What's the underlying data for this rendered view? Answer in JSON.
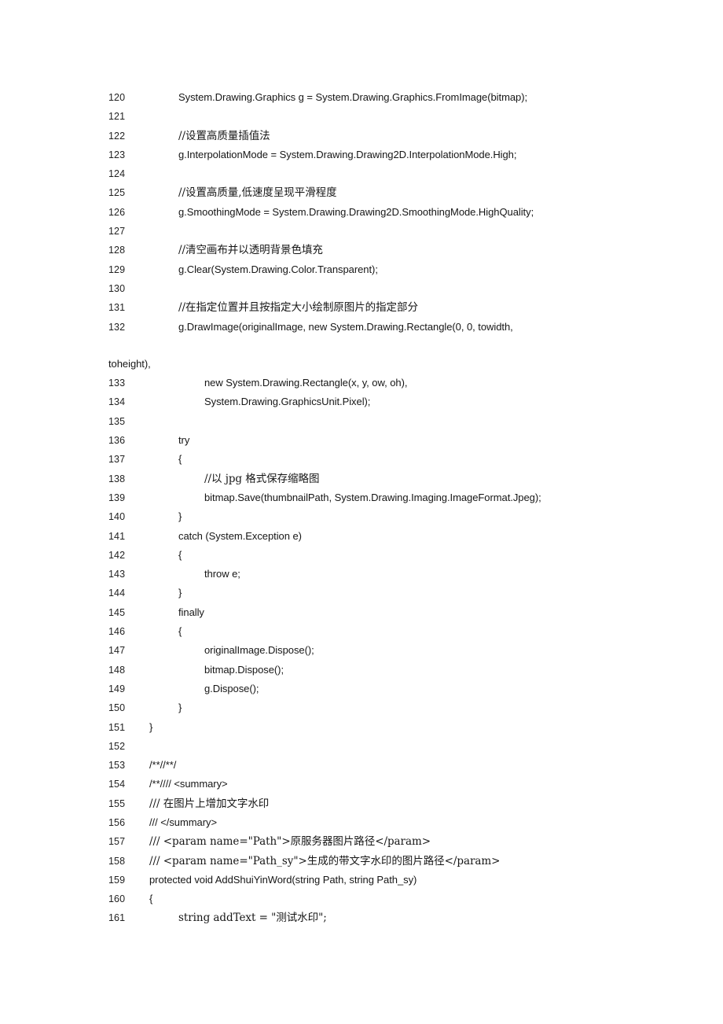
{
  "document": {
    "type": "code-listing",
    "language": "C#",
    "background_color": "#ffffff",
    "text_color": "#161616",
    "first_line_number": 120,
    "last_line_number": 161
  },
  "lines": [
    {
      "n": "120",
      "indent": "i1",
      "text": "System.Drawing.Graphics g = System.Drawing.Graphics.FromImage(bitmap);"
    },
    {
      "n": "121",
      "indent": "i1",
      "text": ""
    },
    {
      "n": "122",
      "indent": "i1",
      "text": "//设置高质量插值法",
      "cjk": true
    },
    {
      "n": "123",
      "indent": "i1",
      "text": "g.InterpolationMode = System.Drawing.Drawing2D.InterpolationMode.High;"
    },
    {
      "n": "124",
      "indent": "i1",
      "text": ""
    },
    {
      "n": "125",
      "indent": "i1",
      "text": "//设置高质量,低速度呈现平滑程度",
      "cjk": true
    },
    {
      "n": "126",
      "indent": "i1",
      "text": "g.SmoothingMode = System.Drawing.Drawing2D.SmoothingMode.HighQuality;"
    },
    {
      "n": "127",
      "indent": "i1",
      "text": ""
    },
    {
      "n": "128",
      "indent": "i1",
      "text": "//清空画布并以透明背景色填充",
      "cjk": true
    },
    {
      "n": "129",
      "indent": "i1",
      "text": "g.Clear(System.Drawing.Color.Transparent);"
    },
    {
      "n": "130",
      "indent": "i1",
      "text": ""
    },
    {
      "n": "131",
      "indent": "i1",
      "text": "//在指定位置并且按指定大小绘制原图片的指定部分",
      "cjk": true
    },
    {
      "n": "132",
      "indent": "i1",
      "text": "g.DrawImage(originalImage, new System.Drawing.Rectangle(0, 0, towidth,"
    }
  ],
  "wrapped_continuation": {
    "text": "toheight),",
    "belongs_to_line": "132"
  },
  "lines_after_wrap": [
    {
      "n": "133",
      "indent": "i2",
      "text": "new System.Drawing.Rectangle(x, y, ow, oh),"
    },
    {
      "n": "134",
      "indent": "i2",
      "text": "System.Drawing.GraphicsUnit.Pixel);"
    },
    {
      "n": "135",
      "indent": "i1",
      "text": ""
    },
    {
      "n": "136",
      "indent": "i1",
      "text": "try"
    },
    {
      "n": "137",
      "indent": "i1",
      "text": "{"
    },
    {
      "n": "138",
      "indent": "i2",
      "text": "//以 jpg 格式保存缩略图",
      "cjk": true
    },
    {
      "n": "139",
      "indent": "i2",
      "text": "bitmap.Save(thumbnailPath, System.Drawing.Imaging.ImageFormat.Jpeg);"
    },
    {
      "n": "140",
      "indent": "i1",
      "text": "}"
    },
    {
      "n": "141",
      "indent": "i1",
      "text": "catch (System.Exception e)"
    },
    {
      "n": "142",
      "indent": "i1",
      "text": "{"
    },
    {
      "n": "143",
      "indent": "i2",
      "text": "throw e;"
    },
    {
      "n": "144",
      "indent": "i1",
      "text": "}"
    },
    {
      "n": "145",
      "indent": "i1",
      "text": "finally"
    },
    {
      "n": "146",
      "indent": "i1",
      "text": "{"
    },
    {
      "n": "147",
      "indent": "i2",
      "text": "originalImage.Dispose();"
    },
    {
      "n": "148",
      "indent": "i2",
      "text": "bitmap.Dispose();"
    },
    {
      "n": "149",
      "indent": "i2",
      "text": "g.Dispose();"
    },
    {
      "n": "150",
      "indent": "i1",
      "text": "}"
    },
    {
      "n": "151",
      "indent": "i0",
      "text": "}"
    },
    {
      "n": "152",
      "indent": "i0",
      "text": ""
    },
    {
      "n": "153",
      "indent": "i0",
      "text": "/**//**/"
    },
    {
      "n": "154",
      "indent": "i0",
      "text": "/**//// <summary>"
    },
    {
      "n": "155",
      "indent": "i0",
      "text": "///  在图片上增加文字水印",
      "cjk": true
    },
    {
      "n": "156",
      "indent": "i0",
      "text": "/// </summary>"
    },
    {
      "n": "157",
      "indent": "i0",
      "text": "/// <param name=\"Path\">原服务器图片路径</param>",
      "cjk": true
    },
    {
      "n": "158",
      "indent": "i0",
      "text": "/// <param name=\"Path_sy\">生成的带文字水印的图片路径</param>",
      "cjk": true
    },
    {
      "n": "159",
      "indent": "i0",
      "text": "protected void AddShuiYinWord(string Path, string Path_sy)"
    },
    {
      "n": "160",
      "indent": "i0",
      "text": "{"
    },
    {
      "n": "161",
      "indent": "i1",
      "text": "string addText = \"测试水印\";",
      "cjk": true
    }
  ]
}
